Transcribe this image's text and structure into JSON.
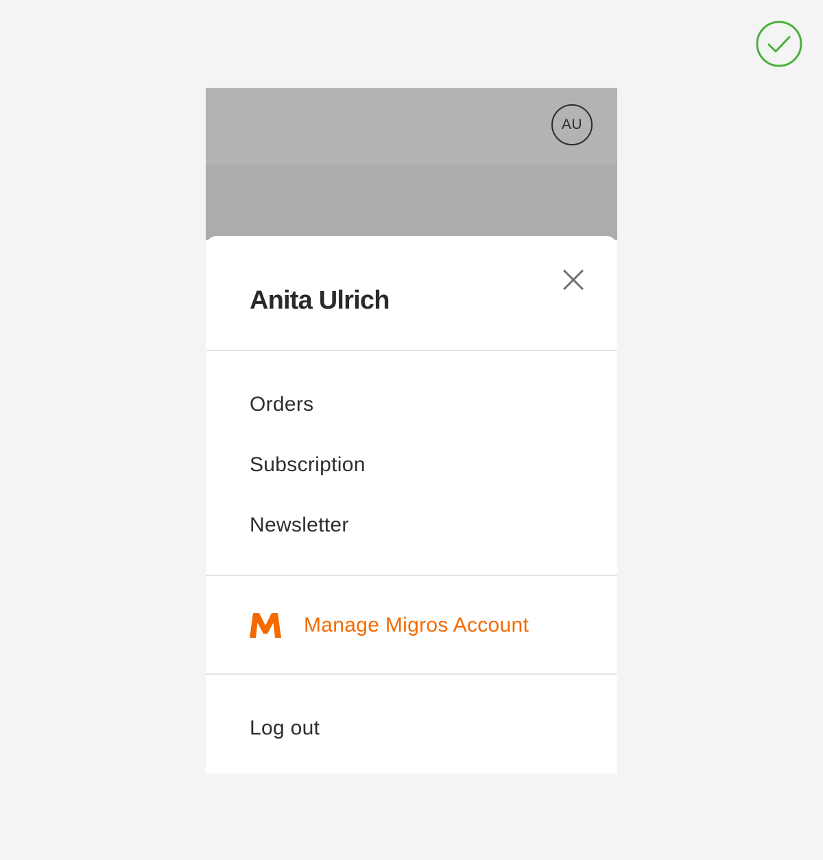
{
  "header": {
    "avatar_initials": "AU"
  },
  "account_menu": {
    "user_name": "Anita Ulrich",
    "items": [
      {
        "label": "Orders"
      },
      {
        "label": "Subscription"
      },
      {
        "label": "Newsletter"
      }
    ],
    "migros_link": {
      "label": "Manage Migros Account",
      "logo_letter": "M",
      "color": "#f46a00"
    },
    "logout_label": "Log out"
  },
  "icons": {
    "status": "check-circle-icon",
    "close": "close-icon"
  },
  "colors": {
    "page_background": "#f4f4f4",
    "header_background": "#b3b3b3",
    "accent_orange": "#f46a00",
    "success_green": "#4caf3e",
    "text_primary": "#2e2e2e"
  }
}
